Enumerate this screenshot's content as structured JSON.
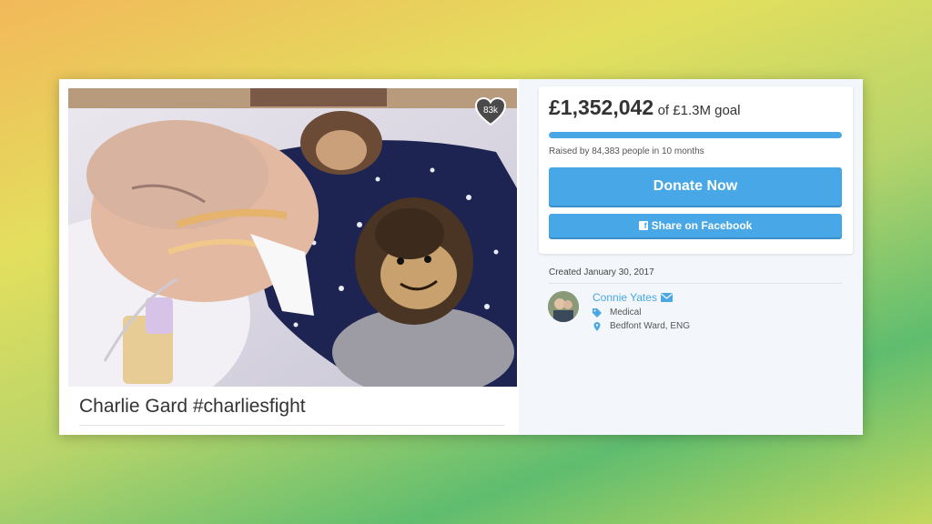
{
  "campaign": {
    "title": "Charlie Gard #charliesfight",
    "likes_count": "83k"
  },
  "donation": {
    "amount_raised": "£1,352,042",
    "goal_text": "of £1.3M goal",
    "progress_fraction": 1.0,
    "raised_by_text": "Raised by 84,383 people in 10 months",
    "donate_label": "Donate Now",
    "share_label": "Share on Facebook"
  },
  "details": {
    "created_text": "Created January 30, 2017",
    "organizer_name": "Connie Yates",
    "category": "Medical",
    "location": "Bedfont Ward, ENG"
  },
  "icons": {
    "heart": "heart-icon",
    "facebook": "facebook-icon",
    "mail": "envelope-icon",
    "tag": "tag-icon",
    "location": "map-pin-icon"
  },
  "colors": {
    "accent": "#48a7e6",
    "progress": "#48a7e4",
    "text_dark": "#333333"
  }
}
